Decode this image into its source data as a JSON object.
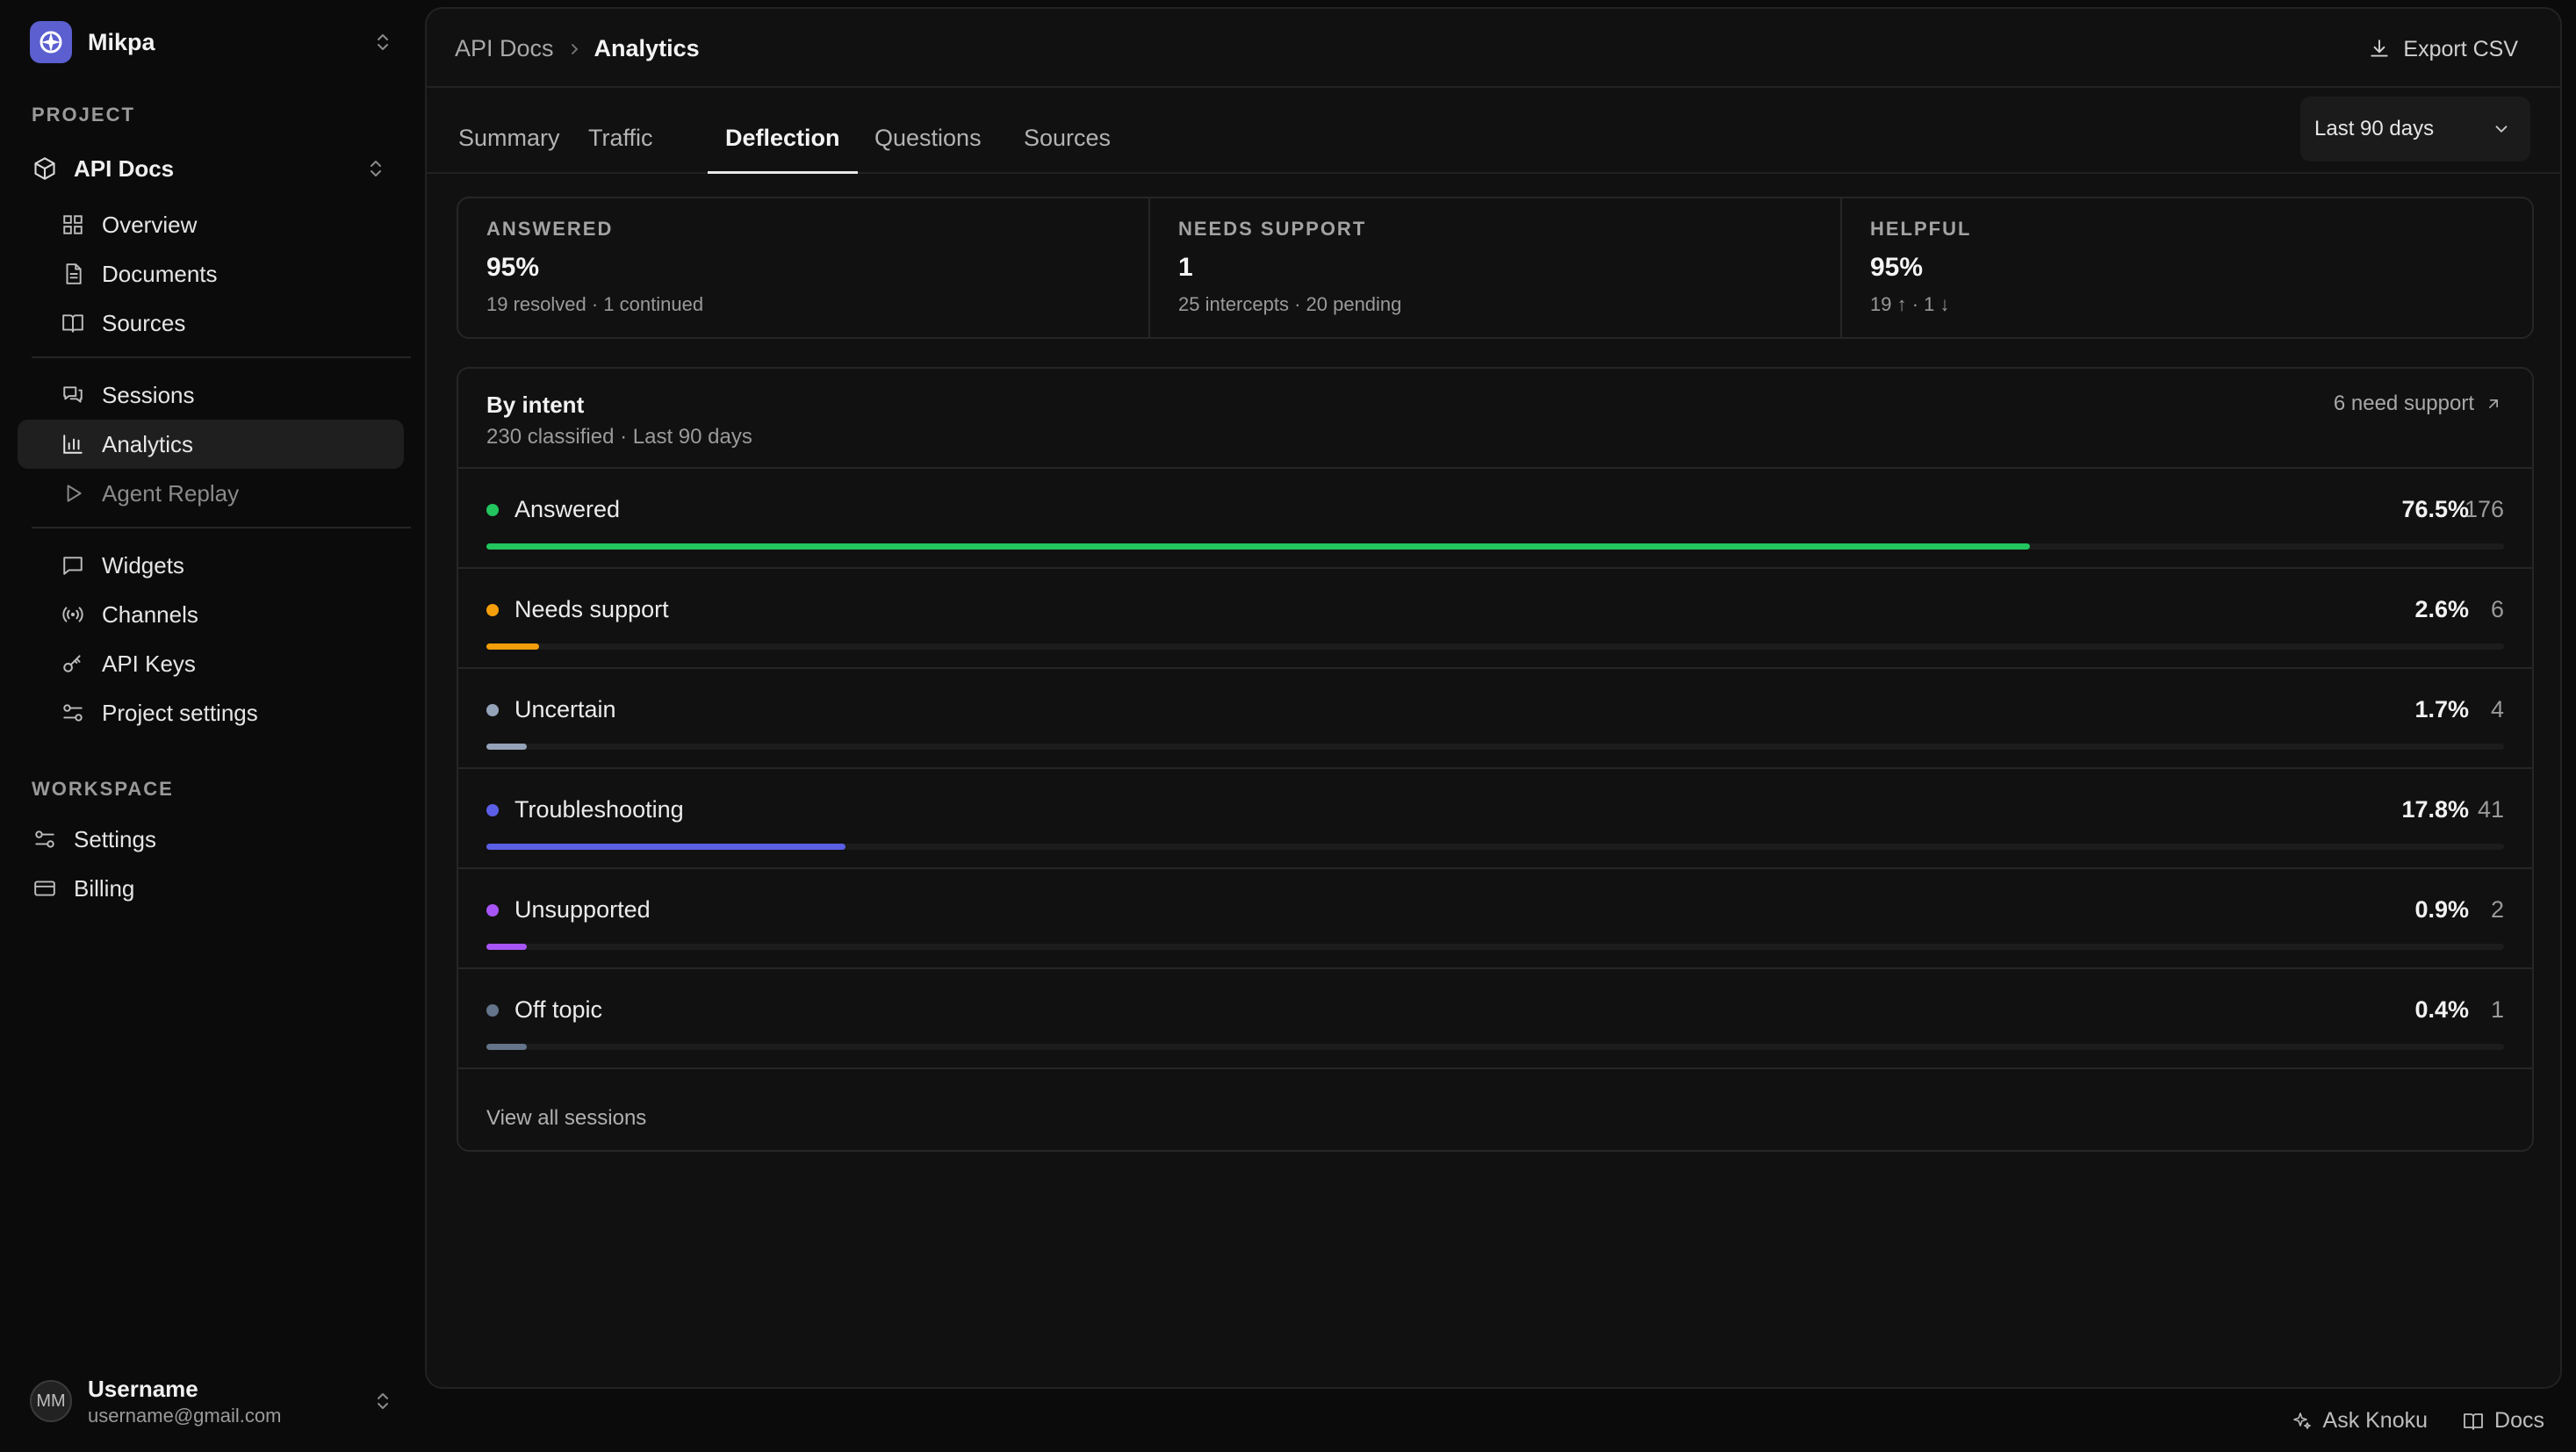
{
  "org": {
    "name": "Mikpa"
  },
  "sidebar": {
    "project_label": "PROJECT",
    "project_name": "API Docs",
    "items_group1": [
      {
        "label": "Overview",
        "icon": "grid-icon"
      },
      {
        "label": "Documents",
        "icon": "document-icon"
      },
      {
        "label": "Sources",
        "icon": "book-icon"
      }
    ],
    "items_group2": [
      {
        "label": "Sessions",
        "icon": "chat-bubbles-icon"
      },
      {
        "label": "Analytics",
        "icon": "bar-chart-icon",
        "active": true
      },
      {
        "label": "Agent Replay",
        "icon": "play-icon",
        "muted": true
      }
    ],
    "items_group3": [
      {
        "label": "Widgets",
        "icon": "message-square-icon"
      },
      {
        "label": "Channels",
        "icon": "broadcast-icon"
      },
      {
        "label": "API Keys",
        "icon": "key-icon"
      },
      {
        "label": "Project settings",
        "icon": "sliders-icon"
      }
    ],
    "workspace_label": "WORKSPACE",
    "workspace_items": [
      {
        "label": "Settings",
        "icon": "sliders-icon"
      },
      {
        "label": "Billing",
        "icon": "credit-card-icon"
      }
    ]
  },
  "user": {
    "initials": "MM",
    "name": "Username",
    "email": "username@gmail.com"
  },
  "header": {
    "breadcrumb_parent": "API Docs",
    "breadcrumb_current": "Analytics",
    "export_label": "Export CSV"
  },
  "tabs": [
    "Summary",
    "Traffic",
    "Deflection",
    "Questions",
    "Sources"
  ],
  "active_tab": "Deflection",
  "range": {
    "selected": "Last 90 days"
  },
  "stats": [
    {
      "label": "ANSWERED",
      "value": "95%",
      "sub": "19 resolved · 1 continued"
    },
    {
      "label": "NEEDS SUPPORT",
      "value": "1",
      "sub": "25 intercepts · 20 pending"
    },
    {
      "label": "HELPFUL",
      "value": "95%",
      "sub": "19 ↑ · 1 ↓"
    }
  ],
  "intent": {
    "title": "By intent",
    "subtitle": "230 classified · Last 90 days",
    "need_link": "6 need support",
    "view_all": "View all sessions",
    "rows": [
      {
        "name": "Answered",
        "pct": "76.5%",
        "count": "176",
        "fraction": 0.765,
        "color": "#22c55e"
      },
      {
        "name": "Needs support",
        "pct": "2.6%",
        "count": "6",
        "fraction": 0.026,
        "color": "#f59e0b"
      },
      {
        "name": "Uncertain",
        "pct": "1.7%",
        "count": "4",
        "fraction": 0.017,
        "color": "#94a3b8"
      },
      {
        "name": "Troubleshooting",
        "pct": "17.8%",
        "count": "41",
        "fraction": 0.178,
        "color": "#5b5fe6"
      },
      {
        "name": "Unsupported",
        "pct": "0.9%",
        "count": "2",
        "fraction": 0.009,
        "color": "#a855f7"
      },
      {
        "name": "Off topic",
        "pct": "0.4%",
        "count": "1",
        "fraction": 0.004,
        "color": "#64748b"
      }
    ]
  },
  "footer": {
    "ask_label": "Ask Knoku",
    "docs_label": "Docs"
  }
}
